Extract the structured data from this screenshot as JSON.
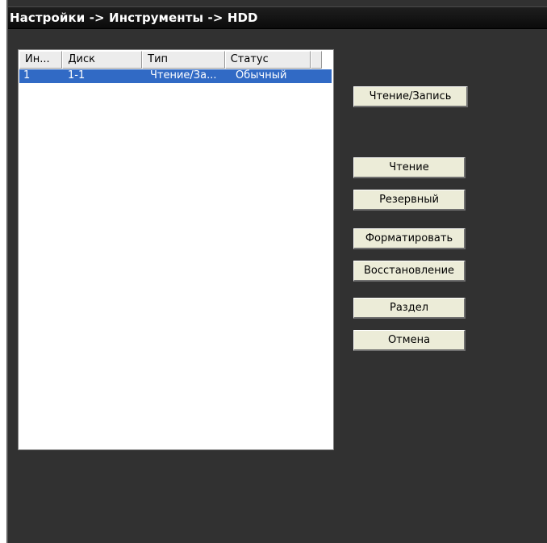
{
  "window": {
    "title": "Настройки -> Инструменты -> HDD"
  },
  "disk_table": {
    "columns": [
      "Ин...",
      "Диск",
      "Тип",
      "Статус"
    ],
    "rows": [
      {
        "index": "1",
        "disk": "1-1",
        "type": "Чтение/За...",
        "status": "Обычный",
        "selected": true
      }
    ]
  },
  "actions": {
    "read_write": "Чтение/Запись",
    "read": "Чтение",
    "reserve": "Резервный",
    "format": "Форматировать",
    "restore": "Восстановление",
    "partition": "Раздел",
    "cancel": "Отмена"
  },
  "colors": {
    "selection": "#316ac5",
    "window_bg": "#313131"
  }
}
